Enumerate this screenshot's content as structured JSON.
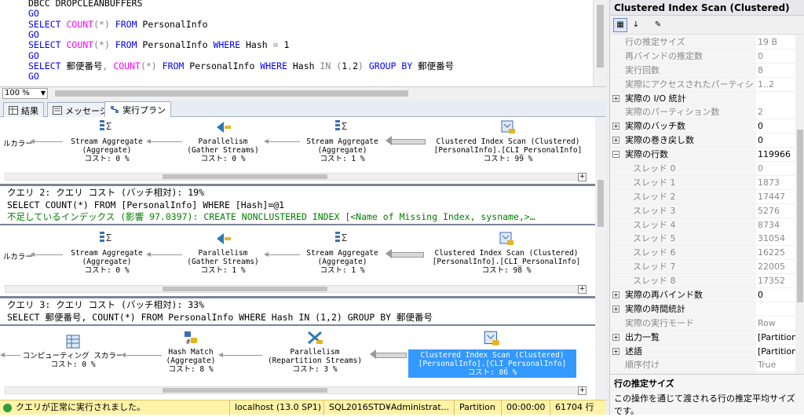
{
  "editor": {
    "lines": [
      {
        "parts": [
          {
            "t": "DBCC DROPCLEANBUFFERS",
            "c": ""
          }
        ]
      },
      {
        "parts": [
          {
            "t": "GO",
            "c": "kw"
          }
        ]
      },
      {
        "parts": [
          {
            "t": "SELECT ",
            "c": "kw"
          },
          {
            "t": "COUNT",
            "c": "fn"
          },
          {
            "t": "(*) ",
            "c": "gy"
          },
          {
            "t": "FROM ",
            "c": "kw"
          },
          {
            "t": "PersonalInfo",
            "c": ""
          }
        ]
      },
      {
        "parts": [
          {
            "t": "GO",
            "c": "kw"
          }
        ]
      },
      {
        "parts": [
          {
            "t": "SELECT ",
            "c": "kw"
          },
          {
            "t": "COUNT",
            "c": "fn"
          },
          {
            "t": "(*) ",
            "c": "gy"
          },
          {
            "t": "FROM ",
            "c": "kw"
          },
          {
            "t": "PersonalInfo ",
            "c": ""
          },
          {
            "t": "WHERE ",
            "c": "kw"
          },
          {
            "t": "Hash ",
            "c": ""
          },
          {
            "t": "= ",
            "c": "gy"
          },
          {
            "t": "1",
            "c": ""
          }
        ]
      },
      {
        "parts": [
          {
            "t": "GO",
            "c": "kw"
          }
        ]
      },
      {
        "parts": [
          {
            "t": "SELECT ",
            "c": "kw"
          },
          {
            "t": "郵便番号",
            "c": ""
          },
          {
            "t": ", ",
            "c": "gy"
          },
          {
            "t": "COUNT",
            "c": "fn"
          },
          {
            "t": "(*) ",
            "c": "gy"
          },
          {
            "t": "FROM ",
            "c": "kw"
          },
          {
            "t": "PersonalInfo ",
            "c": ""
          },
          {
            "t": "WHERE ",
            "c": "kw"
          },
          {
            "t": "Hash ",
            "c": ""
          },
          {
            "t": "IN ",
            "c": "gy"
          },
          {
            "t": "(",
            "c": "gy"
          },
          {
            "t": "1",
            "c": ""
          },
          {
            "t": ",",
            "c": "gy"
          },
          {
            "t": "2",
            "c": ""
          },
          {
            "t": ") ",
            "c": "gy"
          },
          {
            "t": "GROUP BY ",
            "c": "kw"
          },
          {
            "t": "郵便番号",
            "c": ""
          }
        ]
      },
      {
        "parts": [
          {
            "t": "GO",
            "c": "kw"
          }
        ]
      }
    ]
  },
  "zoom": "100 %",
  "tabs": [
    {
      "label": "結果",
      "active": false
    },
    {
      "label": "メッセージ",
      "active": false
    },
    {
      "label": "実行プラン",
      "active": true
    }
  ],
  "query1": {
    "ops": [
      {
        "title": "ルカラー",
        "sub": "",
        "cost": ""
      },
      {
        "title": "Stream Aggregate",
        "sub": "(Aggregate)",
        "cost": "コスト: 0 %"
      },
      {
        "title": "Parallelism",
        "sub": "(Gather Streams)",
        "cost": "コスト: 0 %"
      },
      {
        "title": "Stream Aggregate",
        "sub": "(Aggregate)",
        "cost": "コスト: 1 %"
      },
      {
        "title": "Clustered Index Scan (Clustered)",
        "sub": "[PersonalInfo].[CLI_PersonalInfo]",
        "cost": "コスト: 99 %"
      }
    ]
  },
  "query2": {
    "header": "クエリ 2: クエリ コスト (バッチ相対): 19%",
    "sql": "SELECT COUNT(*) FROM [PersonalInfo] WHERE [Hash]=@1",
    "missing": "不足しているインデックス (影響 97.0397): CREATE NONCLUSTERED INDEX [<Name of Missing Index, sysname,>…",
    "ops": [
      {
        "title": "ルカラー",
        "sub": "",
        "cost": ""
      },
      {
        "title": "Stream Aggregate",
        "sub": "(Aggregate)",
        "cost": "コスト: 0 %"
      },
      {
        "title": "Parallelism",
        "sub": "(Gather Streams)",
        "cost": "コスト: 1 %"
      },
      {
        "title": "Stream Aggregate",
        "sub": "(Aggregate)",
        "cost": "コスト: 1 %"
      },
      {
        "title": "Clustered Index Scan (Clustered)",
        "sub": "[PersonalInfo].[CLI_PersonalInfo]",
        "cost": "コスト: 98 %"
      }
    ]
  },
  "query3": {
    "header": "クエリ 3: クエリ コスト (バッチ相対): 33%",
    "sql": "SELECT 郵便番号, COUNT(*) FROM PersonalInfo WHERE Hash IN (1,2) GROUP BY 郵便番号",
    "ops": [
      {
        "title": "コンピューティング スカラー",
        "sub": "",
        "cost": "コスト: 0 %"
      },
      {
        "title": "Hash Match",
        "sub": "(Aggregate)",
        "cost": "コスト: 8 %"
      },
      {
        "title": "Parallelism",
        "sub": "(Repartition Streams)",
        "cost": "コスト: 3 %"
      },
      {
        "title": "Clustered Index Scan (Clustered)",
        "sub": "[PersonalInfo].[CLI_PersonalInfo]",
        "cost": "コスト: 86 %"
      }
    ]
  },
  "status": {
    "message": "クエリが正常に実行されました。",
    "server": "localhost (13.0 SP1)",
    "login": "SQL2016STD¥Administrat...",
    "database": "Partition",
    "elapsed": "00:00:00",
    "rows": "61704 行"
  },
  "props": {
    "title": "Clustered Index Scan (Clustered)",
    "rows": [
      {
        "k": "行の推定サイズ",
        "v": "19 B",
        "dim": true,
        "exp": "",
        "sub": false
      },
      {
        "k": "再バインドの推定数",
        "v": "0",
        "dim": true,
        "exp": "",
        "sub": false
      },
      {
        "k": "実行回数",
        "v": "8",
        "dim": true,
        "exp": "",
        "sub": false
      },
      {
        "k": "実際にアクセスされたパーティション",
        "v": "1..2",
        "dim": true,
        "exp": "",
        "sub": false
      },
      {
        "k": "実際の I/O 統計",
        "v": "",
        "dim": false,
        "exp": "+",
        "sub": false
      },
      {
        "k": "実際のパーティション数",
        "v": "2",
        "dim": true,
        "exp": "",
        "sub": false
      },
      {
        "k": "実際のバッチ数",
        "v": "0",
        "dim": false,
        "exp": "+",
        "sub": false
      },
      {
        "k": "実際の巻き戻し数",
        "v": "0",
        "dim": false,
        "exp": "+",
        "sub": false
      },
      {
        "k": "実際の行数",
        "v": "119966",
        "dim": false,
        "exp": "−",
        "sub": false
      },
      {
        "k": "スレッド 0",
        "v": "0",
        "dim": true,
        "exp": "",
        "sub": true
      },
      {
        "k": "スレッド 1",
        "v": "1873",
        "dim": true,
        "exp": "",
        "sub": true
      },
      {
        "k": "スレッド 2",
        "v": "17447",
        "dim": true,
        "exp": "",
        "sub": true
      },
      {
        "k": "スレッド 3",
        "v": "5276",
        "dim": true,
        "exp": "",
        "sub": true
      },
      {
        "k": "スレッド 4",
        "v": "8734",
        "dim": true,
        "exp": "",
        "sub": true
      },
      {
        "k": "スレッド 5",
        "v": "31054",
        "dim": true,
        "exp": "",
        "sub": true
      },
      {
        "k": "スレッド 6",
        "v": "16225",
        "dim": true,
        "exp": "",
        "sub": true
      },
      {
        "k": "スレッド 7",
        "v": "22005",
        "dim": true,
        "exp": "",
        "sub": true
      },
      {
        "k": "スレッド 8",
        "v": "17352",
        "dim": true,
        "exp": "",
        "sub": true
      },
      {
        "k": "実際の再バインド数",
        "v": "0",
        "dim": false,
        "exp": "+",
        "sub": false
      },
      {
        "k": "実際の時間統計",
        "v": "",
        "dim": false,
        "exp": "+",
        "sub": false
      },
      {
        "k": "実際の実行モード",
        "v": "Row",
        "dim": true,
        "exp": "",
        "sub": false
      },
      {
        "k": "出力一覧",
        "v": "[Partition",
        "dim": false,
        "exp": "+",
        "sub": false
      },
      {
        "k": "述語",
        "v": "[Partition",
        "dim": false,
        "exp": "+",
        "sub": false
      },
      {
        "k": "順序付け",
        "v": "True",
        "dim": true,
        "exp": "",
        "sub": false
      }
    ],
    "desc_title": "行の推定サイズ",
    "desc_text": "この操作を通じて渡される行の推定平均サイズです。"
  }
}
